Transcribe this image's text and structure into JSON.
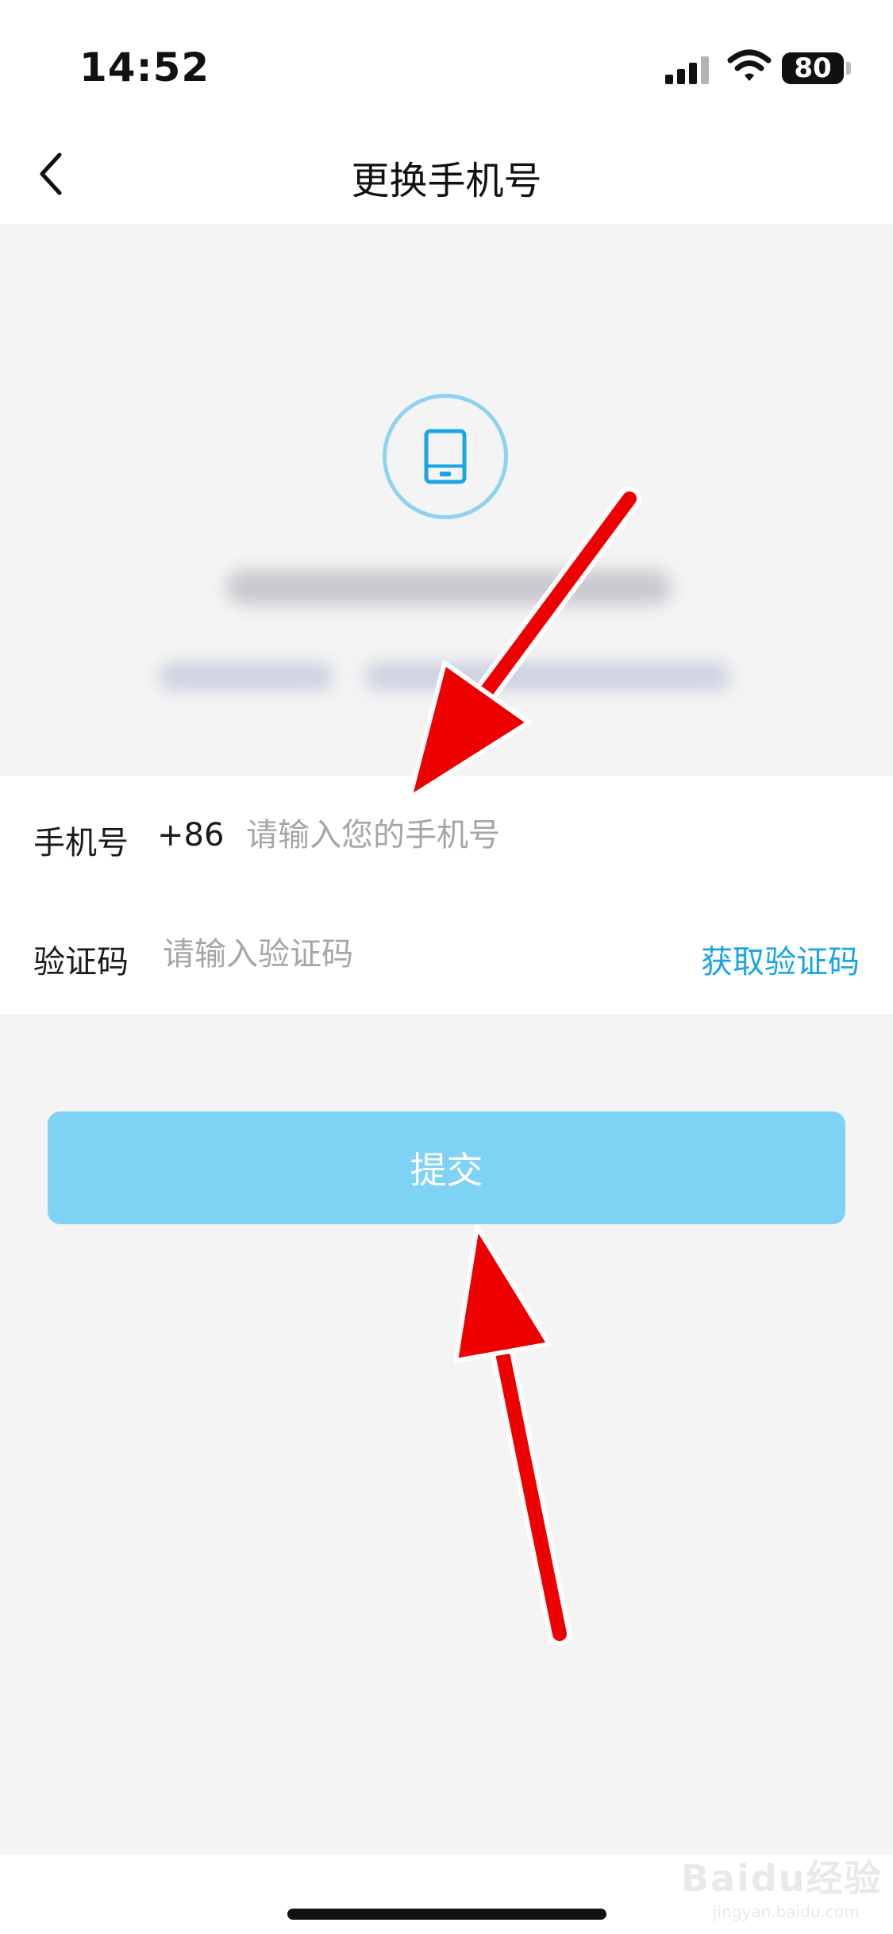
{
  "status_bar": {
    "time": "14:52",
    "battery": "80"
  },
  "nav": {
    "title": "更换手机号"
  },
  "form": {
    "phone_label": "手机号",
    "country_code": "+86",
    "phone_placeholder": "请输入您的手机号",
    "code_label": "验证码",
    "code_placeholder": "请输入验证码",
    "get_code_label": "获取验证码"
  },
  "submit_label": "提交",
  "watermark": {
    "brand": "Baidu经验",
    "url": "jingyan.baidu.com"
  },
  "icons": [
    "back-arrow-icon",
    "phone-device-icon",
    "signal-icon",
    "wifi-icon",
    "battery-icon",
    "annotation-arrow"
  ],
  "colors": {
    "accent": "#1aa5e6",
    "button": "#7ed3f5",
    "badge_ring": "#8fd3f0",
    "page_bg": "#f4f4f4",
    "annotation": "#ee0000"
  }
}
